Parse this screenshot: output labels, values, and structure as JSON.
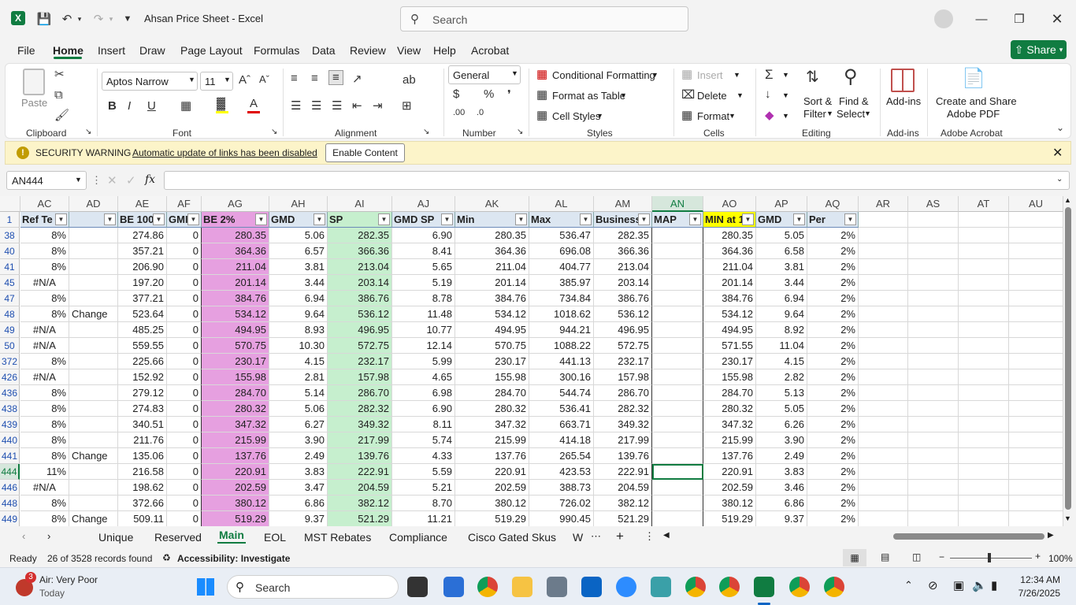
{
  "window": {
    "title": "Ahsan Price Sheet  -  Excel",
    "search_placeholder": "Search"
  },
  "menu": [
    "File",
    "Home",
    "Insert",
    "Draw",
    "Page Layout",
    "Formulas",
    "Data",
    "Review",
    "View",
    "Help",
    "Acrobat"
  ],
  "share_label": "Share",
  "ribbon": {
    "clipboard": {
      "label": "Clipboard",
      "paste": "Paste"
    },
    "font": {
      "label": "Font",
      "name": "Aptos Narrow",
      "size": "11"
    },
    "alignment": {
      "label": "Alignment"
    },
    "number": {
      "label": "Number",
      "format": "General"
    },
    "styles": {
      "label": "Styles",
      "cond": "Conditional Formatting",
      "table": "Format as Table",
      "cell": "Cell Styles"
    },
    "cells": {
      "label": "Cells",
      "insert": "Insert",
      "delete": "Delete",
      "format": "Format"
    },
    "editing": {
      "label": "Editing",
      "sort1": "Sort &",
      "sort2": "Filter",
      "find1": "Find &",
      "find2": "Select"
    },
    "addins": {
      "label": "Add-ins",
      "btn": "Add-ins"
    },
    "acrobat": {
      "label": "Adobe Acrobat",
      "btn1": "Create and Share",
      "btn2": "Adobe PDF"
    }
  },
  "security": {
    "title": "SECURITY WARNING",
    "message": "Automatic update of links has been disabled",
    "button": "Enable Content"
  },
  "formula_bar": {
    "name_box": "AN444",
    "fx": "fx",
    "content": ""
  },
  "columns": [
    "AC",
    "AD",
    "AE",
    "AF",
    "AG",
    "AH",
    "AI",
    "AJ",
    "AK",
    "AL",
    "AM",
    "AN",
    "AO",
    "AP",
    "AQ",
    "AR",
    "AS",
    "AT",
    "AU"
  ],
  "headers": [
    "Ref Te",
    "",
    "BE 100",
    "GMI",
    "BE 2%",
    "GMD",
    "SP",
    "GMD SP",
    "Min",
    "Max",
    "Business",
    "MAP",
    "MIN at 1",
    "GMD",
    "Per"
  ],
  "header_row_num": "1",
  "rows": [
    {
      "r": "38",
      "c": [
        "8%",
        "",
        "274.86",
        "0",
        "280.35",
        "5.06",
        "282.35",
        "6.90",
        "280.35",
        "536.47",
        "282.35",
        "",
        "280.35",
        "5.05",
        "2%"
      ]
    },
    {
      "r": "40",
      "c": [
        "8%",
        "",
        "357.21",
        "0",
        "364.36",
        "6.57",
        "366.36",
        "8.41",
        "364.36",
        "696.08",
        "366.36",
        "",
        "364.36",
        "6.58",
        "2%"
      ]
    },
    {
      "r": "41",
      "c": [
        "8%",
        "",
        "206.90",
        "0",
        "211.04",
        "3.81",
        "213.04",
        "5.65",
        "211.04",
        "404.77",
        "213.04",
        "",
        "211.04",
        "3.81",
        "2%"
      ]
    },
    {
      "r": "45",
      "c": [
        "#N/A",
        "",
        "197.20",
        "0",
        "201.14",
        "3.44",
        "203.14",
        "5.19",
        "201.14",
        "385.97",
        "203.14",
        "",
        "201.14",
        "3.44",
        "2%"
      ]
    },
    {
      "r": "47",
      "c": [
        "8%",
        "",
        "377.21",
        "0",
        "384.76",
        "6.94",
        "386.76",
        "8.78",
        "384.76",
        "734.84",
        "386.76",
        "",
        "384.76",
        "6.94",
        "2%"
      ]
    },
    {
      "r": "48",
      "c": [
        "8%",
        "Change",
        "523.64",
        "0",
        "534.12",
        "9.64",
        "536.12",
        "11.48",
        "534.12",
        "1018.62",
        "536.12",
        "",
        "534.12",
        "9.64",
        "2%"
      ]
    },
    {
      "r": "49",
      "c": [
        "#N/A",
        "",
        "485.25",
        "0",
        "494.95",
        "8.93",
        "496.95",
        "10.77",
        "494.95",
        "944.21",
        "496.95",
        "",
        "494.95",
        "8.92",
        "2%"
      ]
    },
    {
      "r": "50",
      "c": [
        "#N/A",
        "",
        "559.55",
        "0",
        "570.75",
        "10.30",
        "572.75",
        "12.14",
        "570.75",
        "1088.22",
        "572.75",
        "",
        "571.55",
        "11.04",
        "2%"
      ]
    },
    {
      "r": "372",
      "c": [
        "8%",
        "",
        "225.66",
        "0",
        "230.17",
        "4.15",
        "232.17",
        "5.99",
        "230.17",
        "441.13",
        "232.17",
        "",
        "230.17",
        "4.15",
        "2%"
      ]
    },
    {
      "r": "426",
      "c": [
        "#N/A",
        "",
        "152.92",
        "0",
        "155.98",
        "2.81",
        "157.98",
        "4.65",
        "155.98",
        "300.16",
        "157.98",
        "",
        "155.98",
        "2.82",
        "2%"
      ]
    },
    {
      "r": "436",
      "c": [
        "8%",
        "",
        "279.12",
        "0",
        "284.70",
        "5.14",
        "286.70",
        "6.98",
        "284.70",
        "544.74",
        "286.70",
        "",
        "284.70",
        "5.13",
        "2%"
      ]
    },
    {
      "r": "438",
      "c": [
        "8%",
        "",
        "274.83",
        "0",
        "280.32",
        "5.06",
        "282.32",
        "6.90",
        "280.32",
        "536.41",
        "282.32",
        "",
        "280.32",
        "5.05",
        "2%"
      ]
    },
    {
      "r": "439",
      "c": [
        "8%",
        "",
        "340.51",
        "0",
        "347.32",
        "6.27",
        "349.32",
        "8.11",
        "347.32",
        "663.71",
        "349.32",
        "",
        "347.32",
        "6.26",
        "2%"
      ]
    },
    {
      "r": "440",
      "c": [
        "8%",
        "",
        "211.76",
        "0",
        "215.99",
        "3.90",
        "217.99",
        "5.74",
        "215.99",
        "414.18",
        "217.99",
        "",
        "215.99",
        "3.90",
        "2%"
      ]
    },
    {
      "r": "441",
      "c": [
        "8%",
        "Change",
        "135.06",
        "0",
        "137.76",
        "2.49",
        "139.76",
        "4.33",
        "137.76",
        "265.54",
        "139.76",
        "",
        "137.76",
        "2.49",
        "2%"
      ]
    },
    {
      "r": "444",
      "c": [
        "11%",
        "",
        "216.58",
        "0",
        "220.91",
        "3.83",
        "222.91",
        "5.59",
        "220.91",
        "423.53",
        "222.91",
        "",
        "220.91",
        "3.83",
        "2%"
      ]
    },
    {
      "r": "446",
      "c": [
        "#N/A",
        "",
        "198.62",
        "0",
        "202.59",
        "3.47",
        "204.59",
        "5.21",
        "202.59",
        "388.73",
        "204.59",
        "",
        "202.59",
        "3.46",
        "2%"
      ]
    },
    {
      "r": "448",
      "c": [
        "8%",
        "",
        "372.66",
        "0",
        "380.12",
        "6.86",
        "382.12",
        "8.70",
        "380.12",
        "726.02",
        "382.12",
        "",
        "380.12",
        "6.86",
        "2%"
      ]
    },
    {
      "r": "449",
      "c": [
        "8%",
        "Change",
        "509.11",
        "0",
        "519.29",
        "9.37",
        "521.29",
        "11.21",
        "519.29",
        "990.45",
        "521.29",
        "",
        "519.29",
        "9.37",
        "2%"
      ]
    }
  ],
  "colors": {
    "pink": "#e6a0e0",
    "green": "#c6efce",
    "yellow": "#ffff00",
    "accent": "#107c41"
  },
  "sheets": [
    "Unique",
    "Reserved",
    "Main",
    "EOL",
    "MST Rebates",
    "Compliance",
    "Cisco Gated Skus",
    "W"
  ],
  "active_sheet": "Main",
  "status": {
    "ready": "Ready",
    "records": "26 of 3528 records found",
    "accessibility": "Accessibility: Investigate",
    "zoom": "100%"
  },
  "taskbar": {
    "weather_badge": "3",
    "weather_title": "Air: Very Poor",
    "weather_sub": "Today",
    "search": "Search",
    "time": "12:34 AM",
    "date": "7/26/2025"
  }
}
